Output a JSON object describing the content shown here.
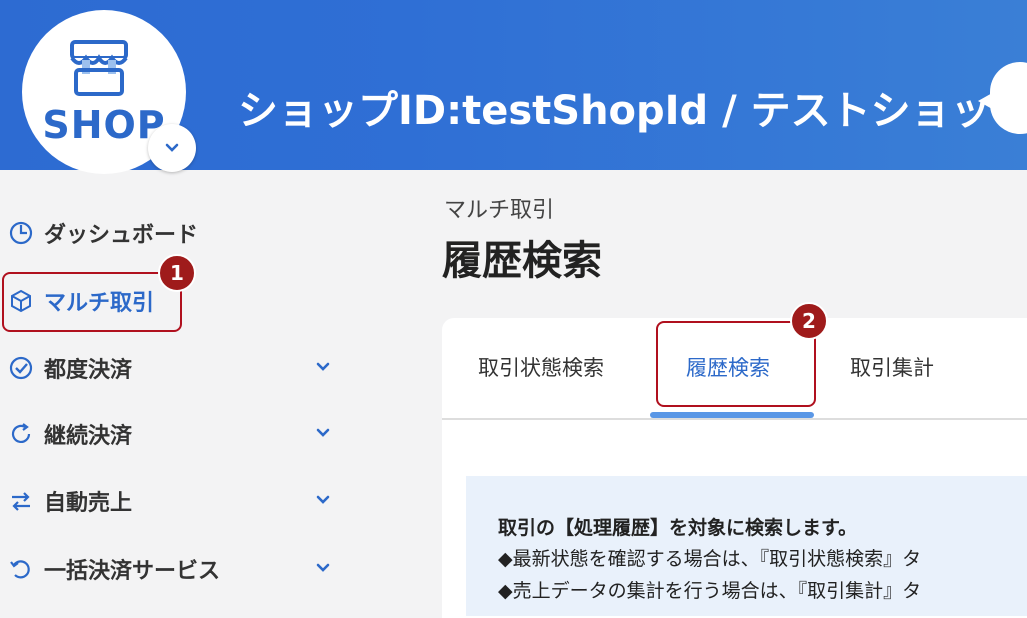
{
  "header": {
    "logo_text": "SHOP",
    "title": "ショップID:testShopId / テストショップ"
  },
  "sidebar": {
    "items": [
      {
        "label": "ダッシュボード",
        "icon": "clock-pie-icon",
        "active": false,
        "has_chevron": false
      },
      {
        "label": "マルチ取引",
        "icon": "cube-icon",
        "active": true,
        "has_chevron": false
      },
      {
        "label": "都度決済",
        "icon": "check-circle-icon",
        "active": false,
        "has_chevron": true
      },
      {
        "label": "継続決済",
        "icon": "refresh-icon",
        "active": false,
        "has_chevron": true
      },
      {
        "label": "自動売上",
        "icon": "swap-arrows-icon",
        "active": false,
        "has_chevron": true
      },
      {
        "label": "一括決済サービス",
        "icon": "rotate-left-icon",
        "active": false,
        "has_chevron": true
      }
    ]
  },
  "main": {
    "breadcrumb": "マルチ取引",
    "title": "履歴検索",
    "tabs": [
      {
        "label": "取引状態検索",
        "active": false
      },
      {
        "label": "履歴検索",
        "active": true
      },
      {
        "label": "取引集計",
        "active": false
      }
    ],
    "info": {
      "line1": "取引の【処理履歴】を対象に検索します。",
      "line2": "◆最新状態を確認する場合は、『取引状態検索』タ",
      "line3": "◆売上データの集計を行う場合は、『取引集計』タ"
    }
  },
  "annotations": {
    "badge1": "1",
    "badge2": "2",
    "color": "#b0101e"
  },
  "colors": {
    "header_blue": "#2f6fd5",
    "accent_blue": "#2c69c9",
    "tab_underline": "#5a97e6",
    "info_bg": "#e9f1fb"
  }
}
